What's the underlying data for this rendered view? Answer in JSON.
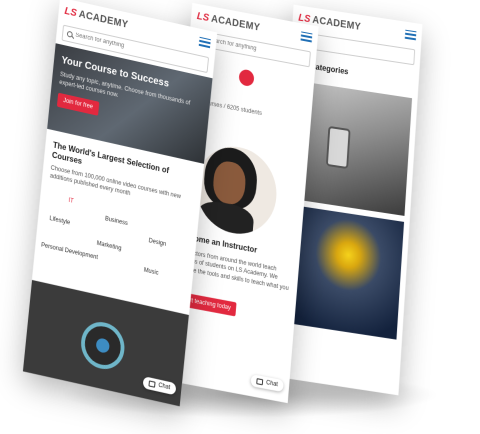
{
  "brand": {
    "mark": "LS",
    "name": "ACADEMY",
    "accent": "#e2293f",
    "menu_color": "#1f6fb5"
  },
  "front": {
    "search_placeholder": "Search for anything",
    "hero": {
      "title": "Your Course to Success",
      "subtitle": "Study any topic, anytime. Choose from thousands of expert-led courses now.",
      "cta": "Join for free"
    },
    "section": {
      "title": "The World's Largest Selection of Courses",
      "text": "Choose from 100,000 online video courses with new additions published every month"
    },
    "categories": [
      "IT",
      "Business",
      "Design",
      "Marketing",
      "Personal Development",
      "Music",
      "Lifestyle"
    ],
    "chat_label": "Chat"
  },
  "middle": {
    "search_placeholder": "Search for anything",
    "stats": "256 courses  /  6205 students",
    "instructor_title": "Become an Instructor",
    "instructor_text": "Instructors from around the world teach millions of students on LS Academy. We provide the tools and skills to teach what you love.",
    "cta": "Start teaching today",
    "chat_label": "Chat"
  },
  "back": {
    "search_placeholder": "",
    "title": "Top Categories"
  },
  "icons": [
    "menu-icon",
    "search-icon",
    "chat-icon"
  ]
}
